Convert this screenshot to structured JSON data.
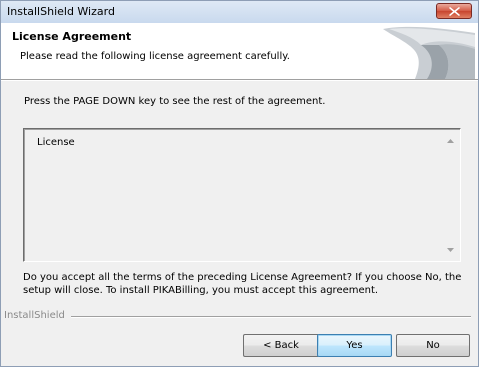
{
  "window": {
    "title": "InstallShield Wizard",
    "close_icon": "close-icon"
  },
  "header": {
    "title": "License Agreement",
    "subtitle": "Please read the following license agreement carefully."
  },
  "instruction": "Press the PAGE DOWN key to see the rest of the agreement.",
  "license": {
    "text": "License"
  },
  "question": "Do you accept all the terms of the preceding License Agreement?  If you choose No,  the setup will close.  To install PIKABilling, you must accept this agreement.",
  "footer": {
    "group_label": "InstallShield",
    "back_label": "< Back",
    "yes_label": "Yes",
    "no_label": "No"
  }
}
